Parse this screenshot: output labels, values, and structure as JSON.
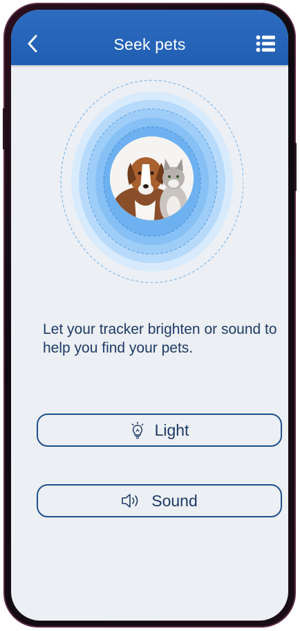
{
  "header": {
    "title": "Seek pets",
    "back_icon": "chevron-left-icon",
    "menu_icon": "list-menu-icon"
  },
  "hero": {
    "image": "dog-and-cat-photo",
    "effect": "radar-pulse-rings"
  },
  "message": {
    "text": "Let your tracker brighten or sound to help you find your pets."
  },
  "actions": {
    "light": {
      "label": "Light",
      "icon": "lightbulb-icon"
    },
    "sound": {
      "label": "Sound",
      "icon": "speaker-icon"
    }
  },
  "colors": {
    "header": "#1f5eb2",
    "accent": "#1d4f8c",
    "text": "#1d3a66",
    "background": "#eceff3",
    "ring": "#5aa6ec"
  }
}
